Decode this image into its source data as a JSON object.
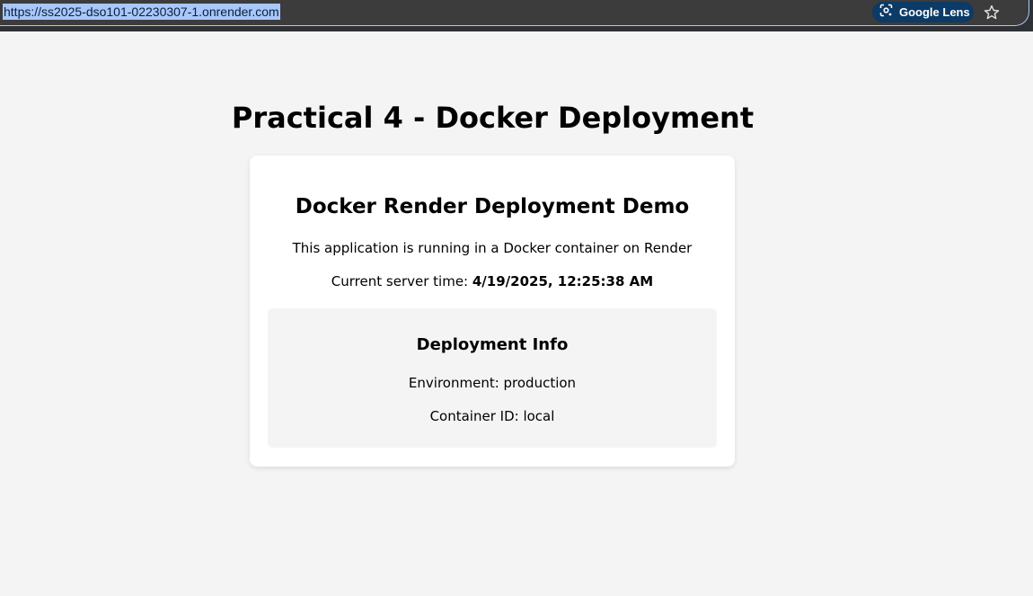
{
  "browser": {
    "url": "https://ss2025-dso101-02230307-1.onrender.com",
    "lens_label": "Google Lens",
    "icons": [
      "site-info-icon",
      "lens-icon",
      "bookmark-star-icon"
    ]
  },
  "page": {
    "title": "Practical 4 - Docker Deployment",
    "card": {
      "title": "Docker Render Deployment Demo",
      "description": "This application is running in a Docker container on Render",
      "server_time_label": "Current server time: ",
      "server_time_value": "4/19/2025, 12:25:38 AM"
    },
    "deployment_info": {
      "title": "Deployment Info",
      "environment": "Environment: production",
      "container": "Container ID: local"
    }
  },
  "colors": {
    "page_background": "#f4f4f4",
    "card_background": "#ffffff",
    "url_highlight": "#a8c7fa",
    "lens_button": "#0b3b66",
    "browser_bar": "#303134"
  }
}
